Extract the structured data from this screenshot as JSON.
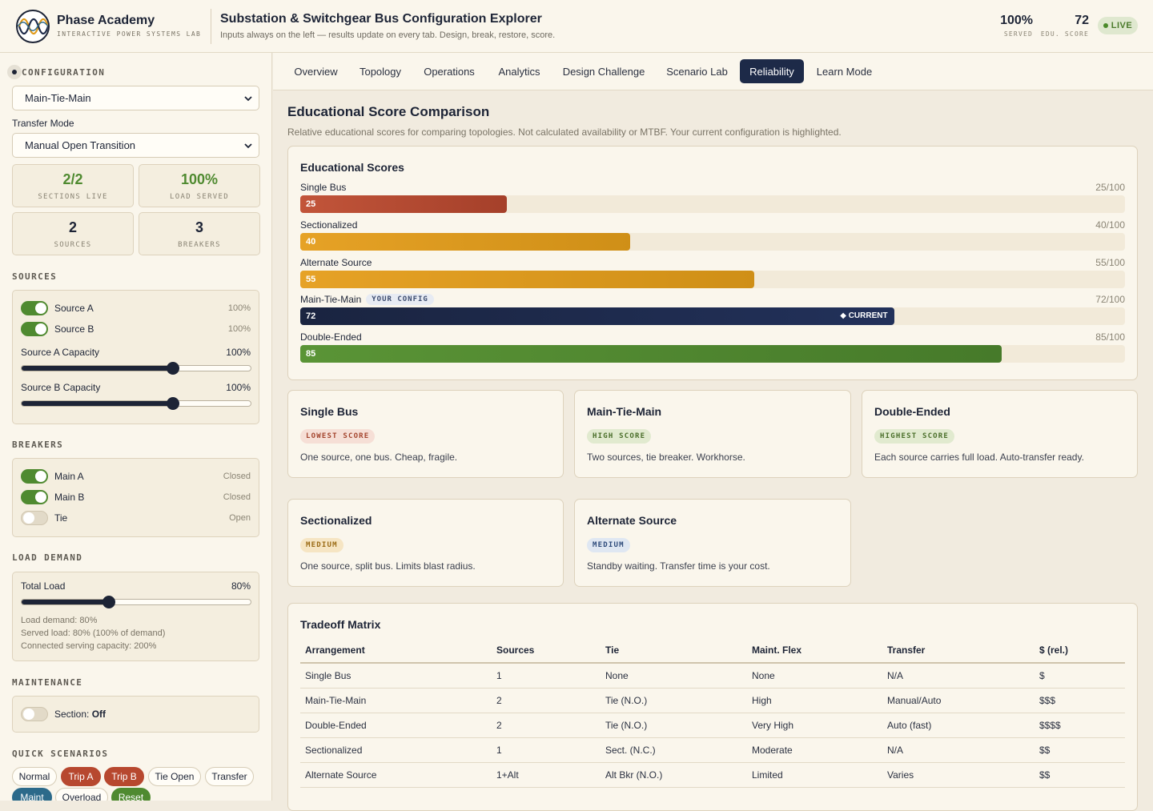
{
  "brand": {
    "name": "Phase Academy",
    "subtitle": "INTERACTIVE POWER SYSTEMS LAB"
  },
  "app": {
    "title": "Substation & Switchgear Bus Configuration Explorer",
    "subtitle": "Inputs always on the left — results update on every tab. Design, break, restore, score."
  },
  "header_stats": {
    "served": {
      "value": "100%",
      "label": "SERVED"
    },
    "score": {
      "value": "72",
      "label": "EDU. SCORE"
    },
    "live": "LIVE"
  },
  "sidebar": {
    "configuration_heading": "CONFIGURATION",
    "configuration_value": "Main-Tie-Main",
    "transfer_mode_label": "Transfer Mode",
    "transfer_mode_value": "Manual Open Transition",
    "stats": [
      {
        "value": "2/2",
        "label": "SECTIONS LIVE",
        "color": "#4f8a30"
      },
      {
        "value": "100%",
        "label": "LOAD SERVED",
        "color": "#4f8a30"
      },
      {
        "value": "2",
        "label": "SOURCES",
        "color": "#1d2436"
      },
      {
        "value": "3",
        "label": "BREAKERS",
        "color": "#1d2436"
      }
    ],
    "sources_heading": "SOURCES",
    "sources": [
      {
        "name": "Source A",
        "value": "100%",
        "on": true
      },
      {
        "name": "Source B",
        "value": "100%",
        "on": true
      }
    ],
    "capacity": [
      {
        "label": "Source A Capacity",
        "value": "100%",
        "level": 0.66
      },
      {
        "label": "Source B Capacity",
        "value": "100%",
        "level": 0.66
      }
    ],
    "breakers_heading": "BREAKERS",
    "breakers": [
      {
        "name": "Main A",
        "state": "Closed",
        "on": true
      },
      {
        "name": "Main B",
        "state": "Closed",
        "on": true
      },
      {
        "name": "Tie",
        "state": "Open",
        "on": false
      }
    ],
    "load_heading": "LOAD DEMAND",
    "load": {
      "label": "Total Load",
      "value": "80%",
      "level": 0.38,
      "lines": [
        "Load demand: 80%",
        "Served load: 80% (100% of demand)",
        "Connected serving capacity: 200%"
      ]
    },
    "maintenance_heading": "MAINTENANCE",
    "maintenance": {
      "label": "Section: ",
      "value": "Off"
    },
    "scenarios_heading": "QUICK SCENARIOS",
    "scenarios": [
      "Normal",
      "Trip A",
      "Trip B",
      "Tie Open",
      "Transfer",
      "Maint",
      "Overload",
      "Reset"
    ]
  },
  "tabs": [
    "Overview",
    "Topology",
    "Operations",
    "Analytics",
    "Design Challenge",
    "Scenario Lab",
    "Reliability",
    "Learn Mode"
  ],
  "main": {
    "title": "Educational Score Comparison",
    "subtitle": "Relative educational scores for comparing topologies. Not calculated availability or MTBF. Your current configuration is highlighted.",
    "scores_title": "Educational Scores",
    "your_config_badge": "YOUR CONFIG",
    "current_marker": "◆ CURRENT"
  },
  "chart_data": {
    "type": "bar",
    "title": "Educational Scores",
    "categories": [
      "Single Bus",
      "Sectionalized",
      "Alternate Source",
      "Main-Tie-Main",
      "Double-Ended"
    ],
    "values": [
      25,
      40,
      55,
      72,
      85
    ],
    "max_labels": [
      "25/100",
      "40/100",
      "55/100",
      "72/100",
      "85/100"
    ],
    "ylim": [
      0,
      100
    ],
    "colors": [
      "#b7482f",
      "#e09a1a",
      "#e09a1a",
      "#1d2a48",
      "#4f8a30"
    ],
    "highlighted": "Main-Tie-Main"
  },
  "cards": [
    {
      "title": "Single Bus",
      "tag": "LOWEST SCORE",
      "tag_style": "red",
      "desc": "One source, one bus. Cheap, fragile."
    },
    {
      "title": "Main-Tie-Main",
      "tag": "HIGH SCORE",
      "tag_style": "green",
      "desc": "Two sources, tie breaker. Workhorse."
    },
    {
      "title": "Double-Ended",
      "tag": "HIGHEST SCORE",
      "tag_style": "green",
      "desc": "Each source carries full load. Auto-transfer ready."
    },
    {
      "title": "Sectionalized",
      "tag": "MEDIUM",
      "tag_style": "amber",
      "desc": "One source, split bus. Limits blast radius."
    },
    {
      "title": "Alternate Source",
      "tag": "MEDIUM",
      "tag_style": "blue",
      "desc": "Standby waiting. Transfer time is your cost."
    }
  ],
  "matrix": {
    "title": "Tradeoff Matrix",
    "headers": [
      "Arrangement",
      "Sources",
      "Tie",
      "Maint. Flex",
      "Transfer",
      "$ (rel.)"
    ],
    "rows": [
      [
        "Single Bus",
        "1",
        "None",
        "None",
        "N/A",
        "$"
      ],
      [
        "Main-Tie-Main",
        "2",
        "Tie (N.O.)",
        "High",
        "Manual/Auto",
        "$$$"
      ],
      [
        "Double-Ended",
        "2",
        "Tie (N.O.)",
        "Very High",
        "Auto (fast)",
        "$$$$"
      ],
      [
        "Sectionalized",
        "1",
        "Sect. (N.C.)",
        "Moderate",
        "N/A",
        "$$"
      ],
      [
        "Alternate Source",
        "1+Alt",
        "Alt Bkr (N.O.)",
        "Limited",
        "Varies",
        "$$"
      ]
    ]
  }
}
